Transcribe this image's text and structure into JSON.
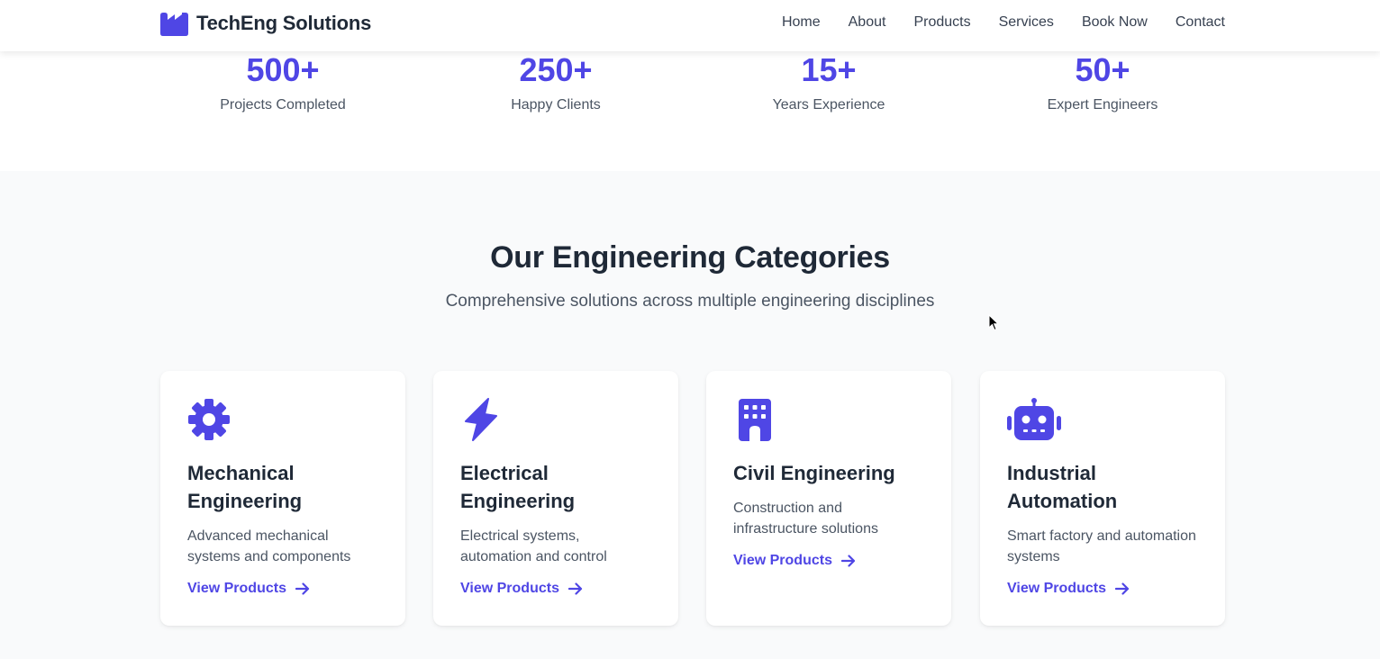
{
  "brand": {
    "name": "TechEng Solutions",
    "icon": "factory-icon"
  },
  "nav": {
    "items": [
      {
        "label": "Home"
      },
      {
        "label": "About"
      },
      {
        "label": "Products"
      },
      {
        "label": "Services"
      },
      {
        "label": "Book Now"
      },
      {
        "label": "Contact"
      }
    ]
  },
  "stats": [
    {
      "value": "500+",
      "label": "Projects Completed"
    },
    {
      "value": "250+",
      "label": "Happy Clients"
    },
    {
      "value": "15+",
      "label": "Years Experience"
    },
    {
      "value": "50+",
      "label": "Expert Engineers"
    }
  ],
  "categories": {
    "title": "Our Engineering Categories",
    "subtitle": "Comprehensive solutions across multiple engineering disciplines",
    "cards": [
      {
        "icon": "gear-icon",
        "title": "Mechanical Engineering",
        "description": "Advanced mechanical systems and components",
        "link": "View Products"
      },
      {
        "icon": "lightning-bolt-icon",
        "title": "Electrical Engineering",
        "description": "Electrical systems, automation and control",
        "link": "View Products"
      },
      {
        "icon": "building-icon",
        "title": "Civil Engineering",
        "description": "Construction and infrastructure solutions",
        "link": "View Products"
      },
      {
        "icon": "robot-icon",
        "title": "Industrial Automation",
        "description": "Smart factory and automation systems",
        "link": "View Products"
      }
    ]
  },
  "colors": {
    "accent": "#4f46e5",
    "heading": "#1f2937",
    "body_text": "#4b5563",
    "section_bg": "#f9fafb"
  }
}
